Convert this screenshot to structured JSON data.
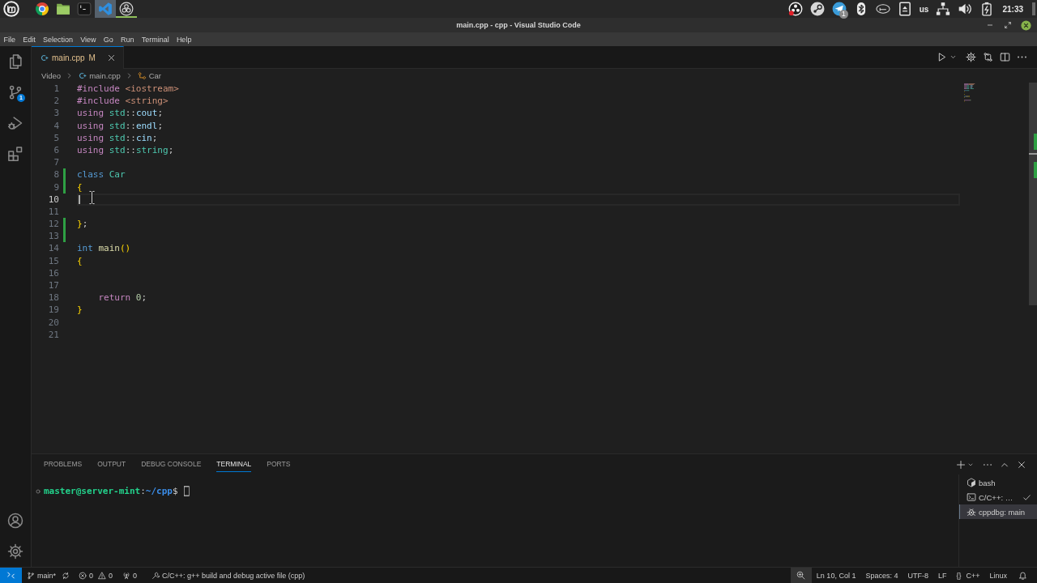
{
  "os_panel": {
    "launchers": [
      {
        "kind": "web-browser",
        "selected": false,
        "running": false
      },
      {
        "kind": "file-manager",
        "selected": false,
        "running": false
      },
      {
        "kind": "terminal",
        "selected": false,
        "running": false
      },
      {
        "kind": "code-editor",
        "selected": true,
        "running": false
      },
      {
        "kind": "screen-recorder",
        "selected": false,
        "running": true
      }
    ],
    "tray": [
      {
        "kind": "screen-recorder"
      },
      {
        "kind": "game-store"
      },
      {
        "kind": "messenger",
        "badge": "1"
      },
      {
        "kind": "bluetooth"
      },
      {
        "kind": "graphics"
      },
      {
        "kind": "removable-drive"
      },
      {
        "kind": "keyboard-layout",
        "label": "us"
      },
      {
        "kind": "network"
      },
      {
        "kind": "volume"
      },
      {
        "kind": "battery"
      }
    ],
    "clock": "21:33"
  },
  "window": {
    "title": "main.cpp - cpp - Visual Studio Code"
  },
  "menu": [
    "File",
    "Edit",
    "Selection",
    "View",
    "Go",
    "Run",
    "Terminal",
    "Help"
  ],
  "activity_bar": {
    "top": [
      {
        "kind": "explorer",
        "selected": false
      },
      {
        "kind": "source-control",
        "selected": false,
        "badge": "1"
      },
      {
        "kind": "run-debug",
        "selected": false
      },
      {
        "kind": "extensions",
        "selected": false
      }
    ],
    "bottom": [
      {
        "kind": "accounts"
      },
      {
        "kind": "settings"
      }
    ]
  },
  "tabs": [
    {
      "label": "main.cpp",
      "status": "M",
      "selected": true
    }
  ],
  "editor_actions": [
    {
      "kind": "run"
    },
    {
      "kind": "run-options"
    },
    {
      "kind": "settings"
    },
    {
      "kind": "compare"
    },
    {
      "kind": "split"
    },
    {
      "kind": "more"
    }
  ],
  "breadcrumbs": [
    {
      "kind": "folder",
      "label": "Video"
    },
    {
      "kind": "cpp-file",
      "label": "main.cpp"
    },
    {
      "kind": "class",
      "label": "Car"
    }
  ],
  "editor": {
    "lines": [
      {
        "number": "1",
        "current": false,
        "changed": false,
        "tokens": [
          {
            "kind": "directive",
            "text": "#include"
          },
          {
            "kind": "include-path",
            "text": " <iostream>"
          }
        ]
      },
      {
        "number": "2",
        "current": false,
        "changed": false,
        "tokens": [
          {
            "kind": "directive",
            "text": "#include"
          },
          {
            "kind": "include-path",
            "text": " <string>"
          }
        ]
      },
      {
        "number": "3",
        "current": false,
        "changed": false,
        "tokens": [
          {
            "kind": "control",
            "text": "using"
          },
          {
            "kind": "namespace",
            "text": " std"
          },
          {
            "kind": "plain",
            "text": "::"
          },
          {
            "kind": "variable",
            "text": "cout"
          },
          {
            "kind": "plain",
            "text": ";"
          }
        ]
      },
      {
        "number": "4",
        "current": false,
        "changed": false,
        "tokens": [
          {
            "kind": "control",
            "text": "using"
          },
          {
            "kind": "namespace",
            "text": " std"
          },
          {
            "kind": "plain",
            "text": "::"
          },
          {
            "kind": "variable",
            "text": "endl"
          },
          {
            "kind": "plain",
            "text": ";"
          }
        ]
      },
      {
        "number": "5",
        "current": false,
        "changed": false,
        "tokens": [
          {
            "kind": "control",
            "text": "using"
          },
          {
            "kind": "namespace",
            "text": " std"
          },
          {
            "kind": "plain",
            "text": "::"
          },
          {
            "kind": "variable",
            "text": "cin"
          },
          {
            "kind": "plain",
            "text": ";"
          }
        ]
      },
      {
        "number": "6",
        "current": false,
        "changed": false,
        "tokens": [
          {
            "kind": "control",
            "text": "using"
          },
          {
            "kind": "namespace",
            "text": " std"
          },
          {
            "kind": "plain",
            "text": "::"
          },
          {
            "kind": "type",
            "text": "string"
          },
          {
            "kind": "plain",
            "text": ";"
          }
        ]
      },
      {
        "number": "7",
        "current": false,
        "changed": false
      },
      {
        "number": "8",
        "current": false,
        "changed": true,
        "tokens": [
          {
            "kind": "storage",
            "text": "class"
          },
          {
            "kind": "type",
            "text": " Car"
          }
        ]
      },
      {
        "number": "9",
        "current": false,
        "changed": true,
        "tokens": [
          {
            "kind": "bracket",
            "text": "{"
          }
        ]
      },
      {
        "number": "10",
        "current": true,
        "changed": false
      },
      {
        "number": "11",
        "current": false,
        "changed": false
      },
      {
        "number": "12",
        "current": false,
        "changed": true,
        "tokens": [
          {
            "kind": "bracket",
            "text": "}"
          },
          {
            "kind": "plain",
            "text": ";"
          }
        ]
      },
      {
        "number": "13",
        "current": false,
        "changed": true
      },
      {
        "number": "14",
        "current": false,
        "changed": false,
        "tokens": [
          {
            "kind": "storage",
            "text": "int"
          },
          {
            "kind": "function",
            "text": " main"
          },
          {
            "kind": "bracket",
            "text": "()"
          }
        ]
      },
      {
        "number": "15",
        "current": false,
        "changed": false,
        "tokens": [
          {
            "kind": "bracket",
            "text": "{"
          }
        ]
      },
      {
        "number": "16",
        "current": false,
        "changed": false
      },
      {
        "number": "17",
        "current": false,
        "changed": false
      },
      {
        "number": "18",
        "current": false,
        "changed": false,
        "tokens": [
          {
            "kind": "control",
            "text": "    return"
          },
          {
            "kind": "number",
            "text": " 0"
          },
          {
            "kind": "plain",
            "text": ";"
          }
        ]
      },
      {
        "number": "19",
        "current": false,
        "changed": false,
        "tokens": [
          {
            "kind": "bracket",
            "text": "}"
          }
        ]
      },
      {
        "number": "20",
        "current": false,
        "changed": false
      },
      {
        "number": "21",
        "current": false,
        "changed": false
      }
    ]
  },
  "panel": {
    "tabs": [
      {
        "label": "PROBLEMS",
        "selected": false
      },
      {
        "label": "OUTPUT",
        "selected": false
      },
      {
        "label": "DEBUG CONSOLE",
        "selected": false
      },
      {
        "label": "TERMINAL",
        "selected": true
      },
      {
        "label": "PORTS",
        "selected": false
      }
    ],
    "actions": [
      {
        "kind": "new-terminal"
      },
      {
        "kind": "launch-profile"
      },
      {
        "kind": "more"
      },
      {
        "kind": "maximize"
      },
      {
        "kind": "close"
      }
    ],
    "terminal": {
      "lines": [
        {
          "parts": [
            {
              "kind": "user",
              "text": "master@server-mint"
            },
            {
              "kind": "plain",
              "text": ":"
            },
            {
              "kind": "path",
              "text": "~/cpp"
            },
            {
              "kind": "plain",
              "text": "$"
            }
          ]
        }
      ]
    },
    "terminals": [
      {
        "kind": "shell",
        "label": "bash",
        "selected": false,
        "succeeded": false
      },
      {
        "kind": "task",
        "label": "C/C++: …",
        "selected": false,
        "succeeded": true
      },
      {
        "kind": "debug",
        "label": "cppdbg: main",
        "selected": true,
        "succeeded": false
      }
    ]
  },
  "status_bar": {
    "left": [
      {
        "kind": "remote"
      },
      {
        "kind": "branch",
        "label": "main*"
      },
      {
        "kind": "sync"
      },
      {
        "kind": "problems",
        "errors": "0",
        "warnings": "0"
      },
      {
        "kind": "ports",
        "label": "0"
      },
      {
        "kind": "task",
        "label": "C/C++: g++ build and debug active file (cpp)"
      }
    ],
    "right": [
      {
        "kind": "zoom"
      },
      {
        "kind": "text",
        "label": "Ln 10, Col 1"
      },
      {
        "kind": "text",
        "label": "Spaces: 4"
      },
      {
        "kind": "text",
        "label": "UTF-8"
      },
      {
        "kind": "text",
        "label": "LF"
      },
      {
        "kind": "language",
        "glyph": "{}",
        "label": "C++"
      },
      {
        "kind": "text",
        "label": "Linux"
      },
      {
        "kind": "notifications"
      }
    ]
  }
}
